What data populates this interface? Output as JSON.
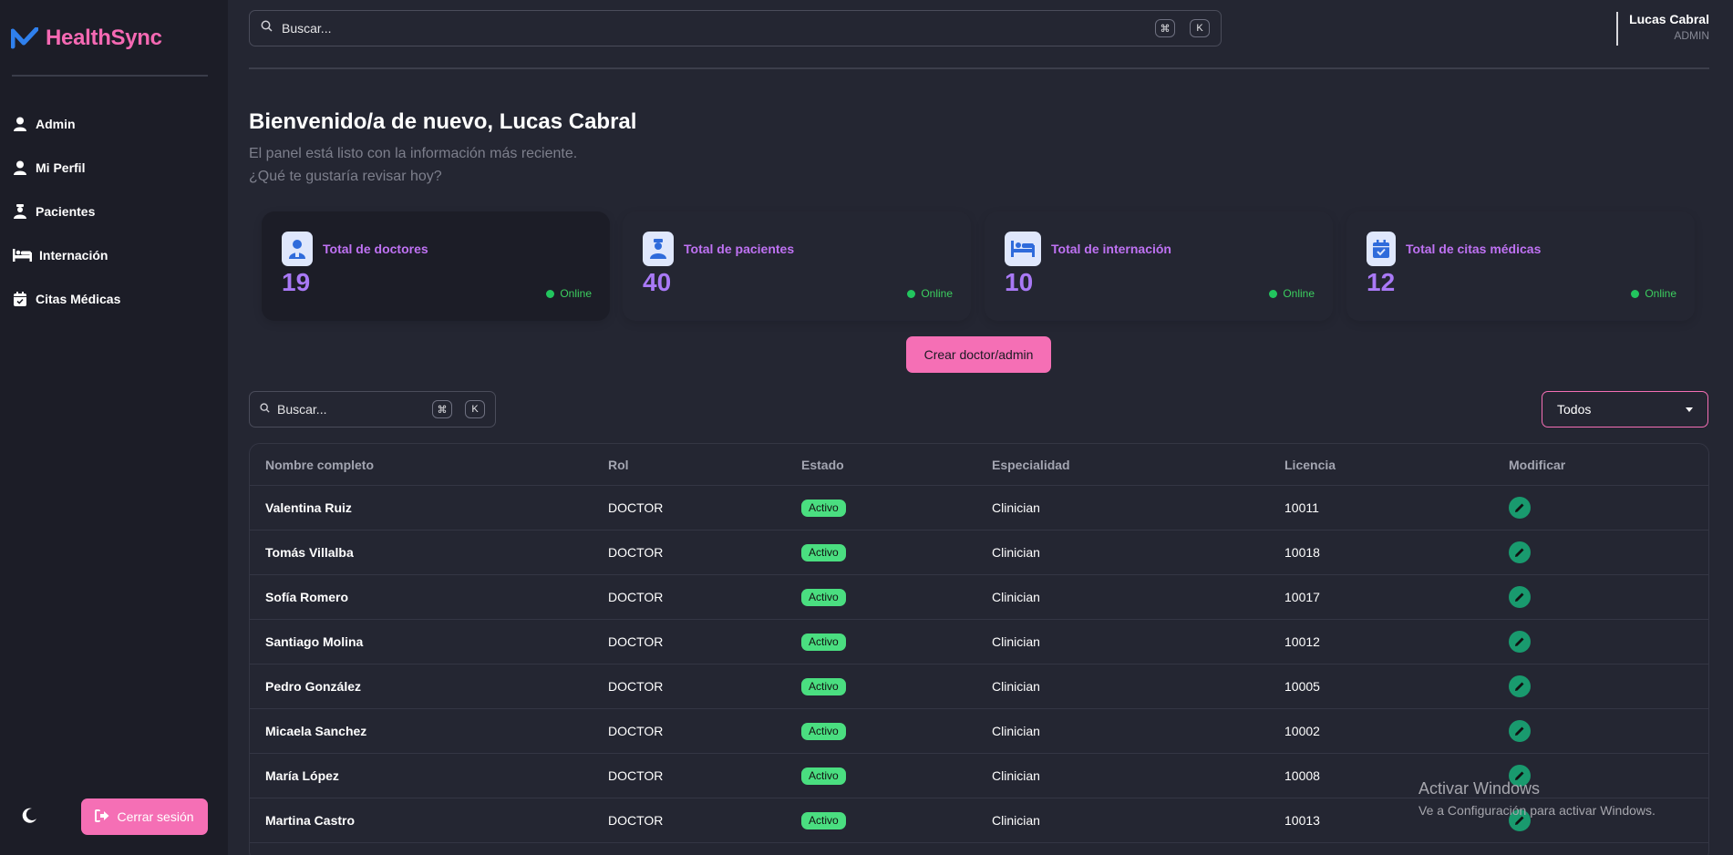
{
  "app": {
    "name": "HealthSync",
    "brand_color": "#f569b3",
    "logo_color": "#2f80ed"
  },
  "sidebar": {
    "items": [
      {
        "label": "Admin",
        "icon": "user-icon"
      },
      {
        "label": "Mi Perfil",
        "icon": "user-icon"
      },
      {
        "label": "Pacientes",
        "icon": "patient-icon"
      },
      {
        "label": "Internación",
        "icon": "bed-icon"
      },
      {
        "label": "Citas Médicas",
        "icon": "calendar-check-icon"
      }
    ],
    "logout_label": "Cerrar sesión",
    "theme_icon": "moon-icon"
  },
  "header": {
    "search_placeholder": "Buscar...",
    "shortcut_modifier": "⌘",
    "shortcut_key": "K",
    "user_name": "Lucas Cabral",
    "user_role": "ADMIN"
  },
  "welcome": {
    "title": "Bienvenido/a de nuevo, Lucas Cabral",
    "subtitle_line1": "El panel está listo con la información más reciente.",
    "subtitle_line2": "¿Qué te gustaría revisar hoy?"
  },
  "stats": [
    {
      "label": "Total de doctores",
      "value": "19",
      "status": "Online",
      "icon": "doctor-icon"
    },
    {
      "label": "Total de pacientes",
      "value": "40",
      "status": "Online",
      "icon": "patient-icon"
    },
    {
      "label": "Total de internación",
      "value": "10",
      "status": "Online",
      "icon": "bed-icon"
    },
    {
      "label": "Total de citas médicas",
      "value": "12",
      "status": "Online",
      "icon": "calendar-check-icon"
    }
  ],
  "actions": {
    "create_label": "Crear doctor/admin"
  },
  "filters": {
    "search_placeholder": "Buscar...",
    "shortcut_modifier": "⌘",
    "shortcut_key": "K",
    "select_value": "Todos"
  },
  "table": {
    "columns": [
      "Nombre completo",
      "Rol",
      "Estado",
      "Especialidad",
      "Licencia",
      "Modificar"
    ],
    "rows": [
      {
        "name": "Valentina Ruiz",
        "role": "DOCTOR",
        "status": "Activo",
        "specialty": "Clinician",
        "license": "10011"
      },
      {
        "name": "Tomás Villalba",
        "role": "DOCTOR",
        "status": "Activo",
        "specialty": "Clinician",
        "license": "10018"
      },
      {
        "name": "Sofía Romero",
        "role": "DOCTOR",
        "status": "Activo",
        "specialty": "Clinician",
        "license": "10017"
      },
      {
        "name": "Santiago Molina",
        "role": "DOCTOR",
        "status": "Activo",
        "specialty": "Clinician",
        "license": "10012"
      },
      {
        "name": "Pedro González",
        "role": "DOCTOR",
        "status": "Activo",
        "specialty": "Clinician",
        "license": "10005"
      },
      {
        "name": "Micaela Sanchez",
        "role": "DOCTOR",
        "status": "Activo",
        "specialty": "Clinician",
        "license": "10002"
      },
      {
        "name": "María López",
        "role": "DOCTOR",
        "status": "Activo",
        "specialty": "Clinician",
        "license": "10008"
      },
      {
        "name": "Martina Castro",
        "role": "DOCTOR",
        "status": "Activo",
        "specialty": "Clinician",
        "license": "10013"
      }
    ]
  },
  "watermark": {
    "line1": "Activar Windows",
    "line2": "Ve a Configuración para activar Windows."
  },
  "colors": {
    "background": "#242632",
    "sidebar": "#1c1d27",
    "accent_pink": "#f56fb5",
    "stat_value": "#a979f6",
    "stat_label": "#bf72f3",
    "online_green": "#22c55e",
    "active_badge": "#4ade80",
    "edit_button": "#199a6e"
  }
}
